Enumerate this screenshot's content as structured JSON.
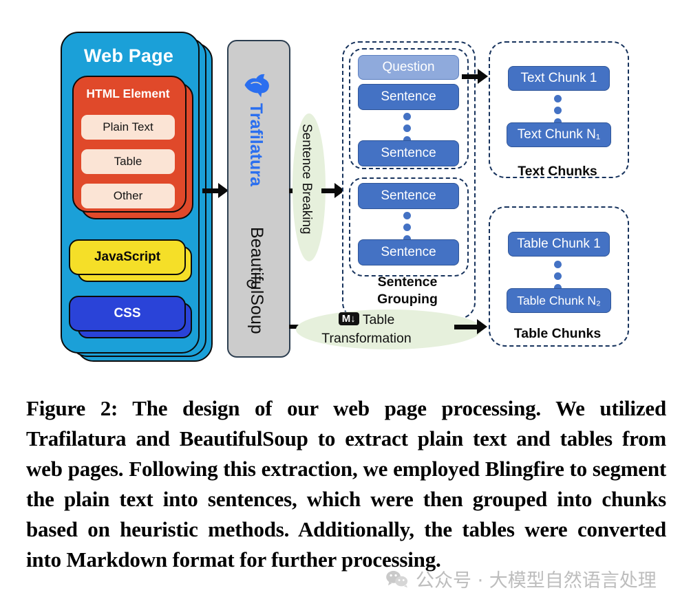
{
  "figure": {
    "webpage": {
      "title": "Web Page",
      "html_element": {
        "title": "HTML Element",
        "items": [
          "Plain Text",
          "Table",
          "Other"
        ]
      },
      "javascript": "JavaScript",
      "css": "CSS"
    },
    "extractors": {
      "trafilatura": "Trafilatura",
      "beautifulsoup": "BeautifulSoup",
      "trafilatura_color": "#2B6FEF",
      "panel_color": "#CCCCCC"
    },
    "processes": {
      "sentence_breaking": "Sentence Breaking",
      "table_transformation_line1": "Table",
      "table_transformation_line2": "Transformation",
      "markdown_badge": "M↓",
      "ellipse_color": "#E6F0DC"
    },
    "sentence_grouping": {
      "label_line1": "Sentence",
      "label_line2": "Grouping",
      "group1": [
        "Question",
        "Sentence",
        "Sentence"
      ],
      "group2": [
        "Sentence",
        "Sentence"
      ]
    },
    "text_chunks": {
      "label": "Text Chunks",
      "first": "Text Chunk 1",
      "last": "Text Chunk N₁"
    },
    "table_chunks": {
      "label": "Table Chunks",
      "first": "Table Chunk 1",
      "last": "Table Chunk N₂"
    },
    "colors": {
      "webpage_blue": "#1BA0D8",
      "html_red": "#E0492A",
      "cream": "#FBE4D5",
      "javascript_yellow": "#F5DF28",
      "css_blue": "#2A43D8",
      "chunk_blue": "#4472C4",
      "question_blue": "#8FAADC",
      "dashed_border": "#16325C"
    }
  },
  "caption": "Figure 2: The design of our web page processing. We utilized Trafilatura and BeautifulSoup to extract plain text and tables from web pages. Following this extraction, we employed Blingfire to segment the plain text into sentences, which were then grouped into chunks based on heuristic methods. Additionally, the tables were converted into Markdown format for further processing.",
  "watermark": {
    "text": "公众号 · 大模型自然语言处理",
    "icon": "wechat-icon"
  }
}
